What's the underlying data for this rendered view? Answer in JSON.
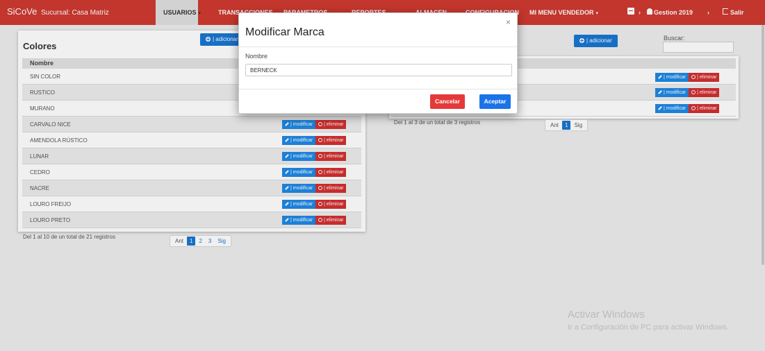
{
  "navbar": {
    "brand": "SiCoVe",
    "brand_sub": "Sucursal: Casa Matriz",
    "menu": {
      "usuarios": "USUARIOS",
      "transacciones": "TRANSACCIONES",
      "parametros": "PARAMETROS",
      "reportes": "REPORTES",
      "almacen": "ALMACEN",
      "configuracion": "CONFIGURACION",
      "vendedor": "MI MENU VENDEDOR"
    },
    "gestion": "Gestion 2019",
    "salir": "Salir",
    "colors": {
      "bar": "#cf3a30",
      "active_item": "#e0e0e0"
    }
  },
  "left_panel": {
    "title": "Colores",
    "add_label": "| adicionar",
    "header": "Nombre",
    "rows": [
      "SIN COLOR",
      "RUSTICO",
      "MURANO",
      "CARVALO NICE",
      "AMENDOLA RÚSTICO",
      "LUNAR",
      "CEDRO",
      "NACRE",
      "LOURO FREIJO",
      "LOURO PRETO"
    ],
    "modify_label": "| modificar",
    "delete_label": "| eliminar",
    "info": "Del 1 al 10 de un total de 21 registros",
    "pager": {
      "prev": "Ant",
      "pages": [
        "1",
        "2",
        "3"
      ],
      "next": "Sig",
      "current": "1"
    }
  },
  "right_panel": {
    "add_label": "| adicionar",
    "search_label": "Buscar:",
    "search_value": "",
    "modify_label": "| modificar",
    "delete_label": "| eliminar",
    "info": "Del 1 al 3 de un total de 3 registros",
    "pager": {
      "prev": "Ant",
      "pages": [
        "1"
      ],
      "next": "Sig",
      "current": "1"
    }
  },
  "modal": {
    "title": "Modificar Marca",
    "close": "×",
    "field_label": "Nombre",
    "field_value": "BERNECK",
    "cancel": "Cancelar",
    "accept": "Aceptar",
    "colors": {
      "cancel": "#e53939",
      "accept": "#1a73e8"
    }
  },
  "watermark": {
    "line1": "Activar Windows",
    "line2": "Ir a Configuración de PC para activar Windows."
  }
}
